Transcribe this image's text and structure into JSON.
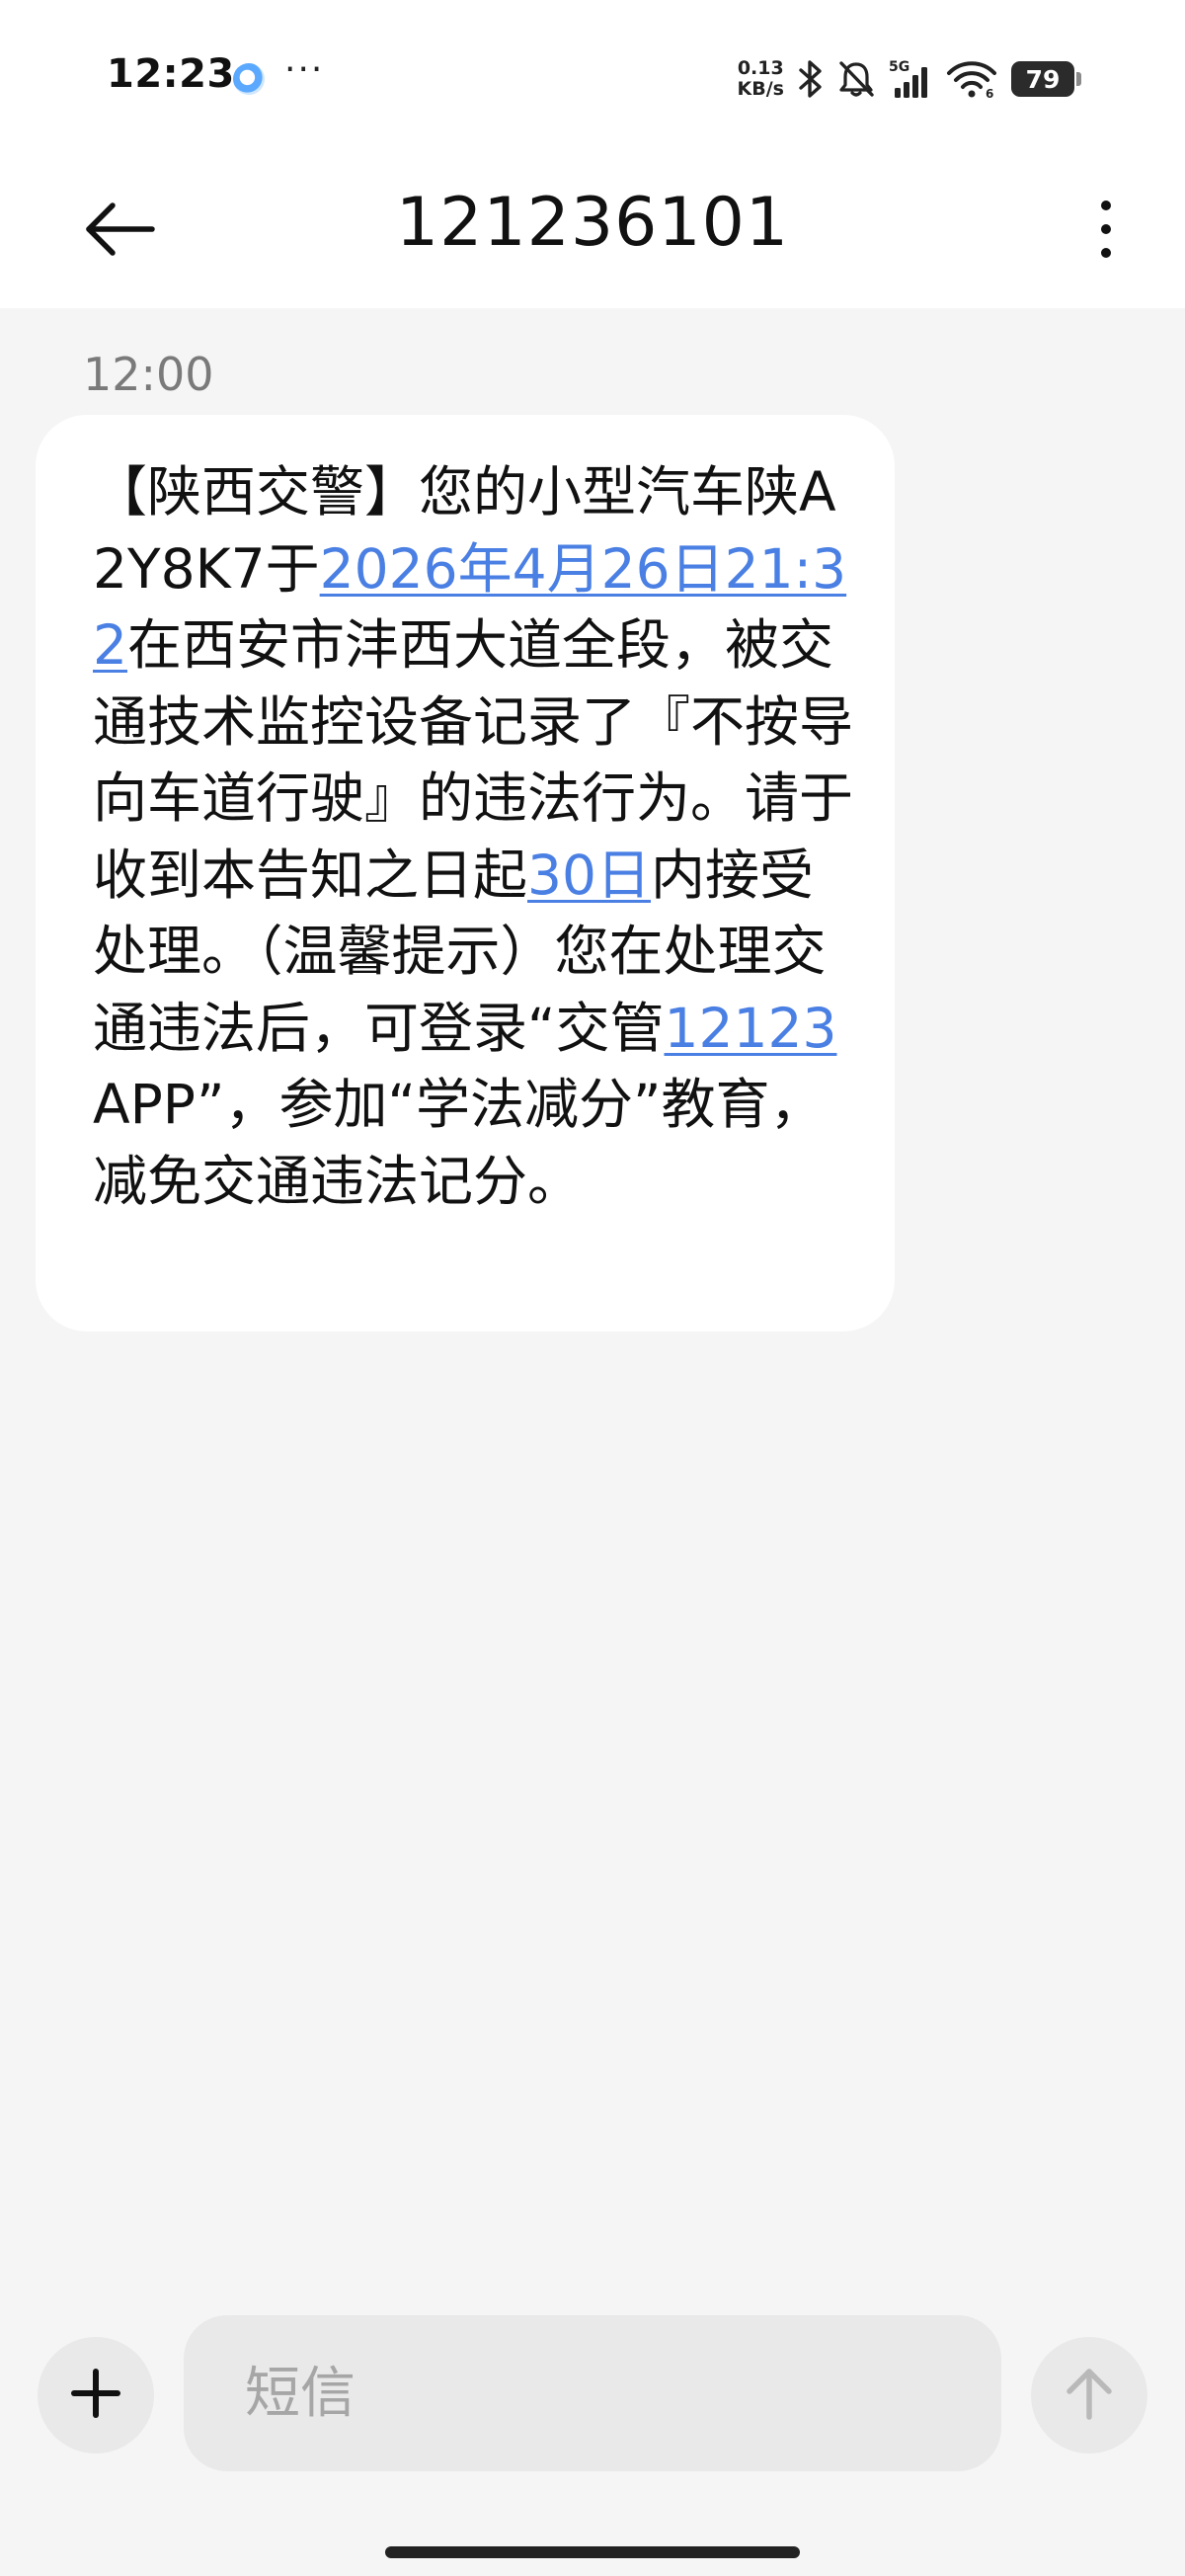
{
  "status_bar": {
    "time": "12:23",
    "more_indicator": "···",
    "net_speed_value": "0.13",
    "net_speed_unit": "KB/s",
    "network_label": "5G",
    "wifi_label": "6",
    "battery": "79",
    "icons": [
      "app-notification-icon",
      "bluetooth-icon",
      "mute-icon",
      "cellular-signal-icon",
      "wifi-icon",
      "battery-icon"
    ]
  },
  "header": {
    "title": "121236101",
    "back_icon": "arrow-left-icon",
    "menu_icon": "more-vertical-icon"
  },
  "conversation": {
    "messages": [
      {
        "time": "12:00",
        "segments": [
          {
            "text": "【陕西交警】您的小型汽车陕A2Y8K7于",
            "link": false
          },
          {
            "text": "2026年4月26日21:32",
            "link": true
          },
          {
            "text": "在西安市沣西大道全段，被交通技术监控设备记录了『不按导向车道行驶』的违法行为。请于收到本告知之日起",
            "link": false
          },
          {
            "text": "30日",
            "link": true
          },
          {
            "text": "内接受处理。（温馨提示）您在处理交通违法后，可登录“交管",
            "link": false
          },
          {
            "text": "12123",
            "link": true
          },
          {
            "text": "APP”，参加“学法减分”教育，减免交通违法记分。",
            "link": false
          }
        ]
      }
    ]
  },
  "composer": {
    "placeholder": "短信",
    "value": "",
    "add_icon": "plus-icon",
    "send_icon": "arrow-up-icon"
  },
  "colors": {
    "background": "#f5f5f5",
    "bar": "#ffffff",
    "bubble": "#ffffff",
    "link": "#4a7fe3",
    "control_bg": "#e9e9e9",
    "muted_text": "#7a7a7a"
  }
}
